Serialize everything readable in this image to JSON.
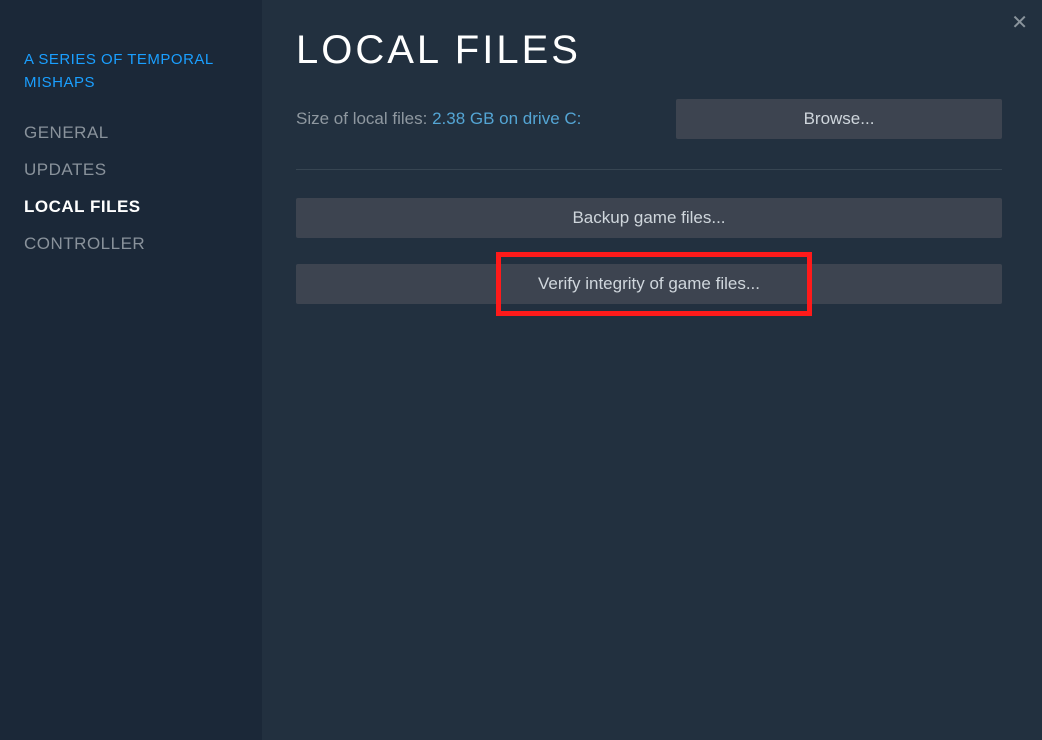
{
  "sidebar": {
    "game_title": "A SERIES OF TEMPORAL MISHAPS",
    "items": [
      {
        "label": "GENERAL",
        "active": false
      },
      {
        "label": "UPDATES",
        "active": false
      },
      {
        "label": "LOCAL FILES",
        "active": true
      },
      {
        "label": "CONTROLLER",
        "active": false
      }
    ]
  },
  "main": {
    "title": "LOCAL FILES",
    "size_label": "Size of local files:",
    "size_value": "2.38 GB on drive C:",
    "browse_button": "Browse...",
    "backup_button": "Backup game files...",
    "verify_button": "Verify integrity of game files..."
  },
  "close_label": "✕"
}
